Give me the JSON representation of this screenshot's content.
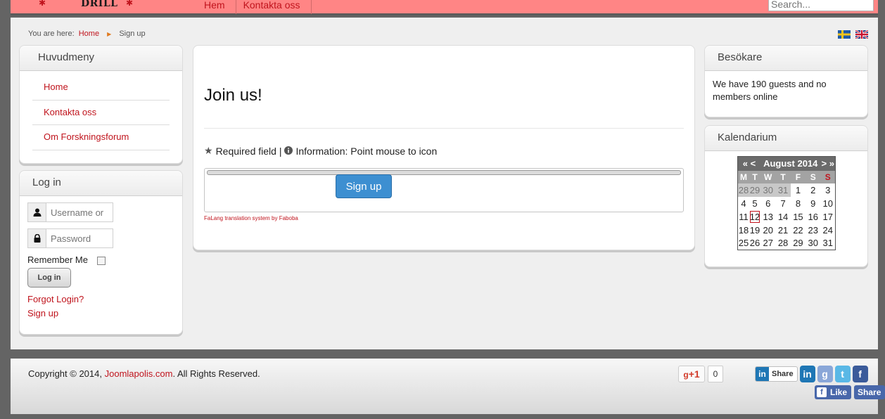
{
  "header": {
    "site_name": "DRILL",
    "nav": [
      "Hem",
      "Kontakta oss"
    ],
    "search_placeholder": "Search..."
  },
  "breadcrumb": {
    "prefix": "You are here:",
    "home": "Home",
    "current": "Sign up"
  },
  "languages": [
    "Svenska",
    "English"
  ],
  "main_menu": {
    "title": "Huvudmeny",
    "items": [
      "Home",
      "Kontakta oss",
      "Om Forskningsforum"
    ]
  },
  "login": {
    "title": "Log in",
    "username_placeholder": "Username or",
    "password_placeholder": "Password",
    "remember_label": "Remember Me",
    "login_button": "Log in",
    "forgot": "Forgot Login?",
    "signup": "Sign up"
  },
  "content": {
    "heading": "Join us!",
    "required_text": "Required field |",
    "info_text": "Information: Point mouse to icon",
    "signup_button": "Sign up",
    "falang_credit": "FaLang translation system by Faboba"
  },
  "visitors": {
    "title": "Besökare",
    "text": "We have 190 guests and no members online"
  },
  "calendar": {
    "title": "Kalendarium",
    "prev_year": "«",
    "prev_month": "<",
    "month_label": "August 2014",
    "next_month": ">",
    "next_year": "»",
    "weekdays": [
      "M",
      "T",
      "W",
      "T",
      "F",
      "S",
      "S"
    ],
    "weeks": [
      [
        "28",
        "29",
        "30",
        "31",
        "1",
        "2",
        "3"
      ],
      [
        "4",
        "5",
        "6",
        "7",
        "8",
        "9",
        "10"
      ],
      [
        "11",
        "12",
        "13",
        "14",
        "15",
        "16",
        "17"
      ],
      [
        "18",
        "19",
        "20",
        "21",
        "22",
        "23",
        "24"
      ],
      [
        "25",
        "26",
        "27",
        "28",
        "29",
        "30",
        "31"
      ]
    ],
    "today": "12"
  },
  "footer": {
    "copyright_prefix": "Copyright © 2014,",
    "copyright_link": "Joomlapolis.com",
    "copyright_suffix": ". All Rights Reserved.",
    "gplus_label": "+1",
    "gplus_count": "0",
    "linkedin_share": "Share",
    "fb_like": "Like",
    "fb_share": "Share"
  },
  "colors": {
    "topbar": "#ff8585",
    "link": "#c0141d",
    "signup_button": "#3d8fd1"
  }
}
